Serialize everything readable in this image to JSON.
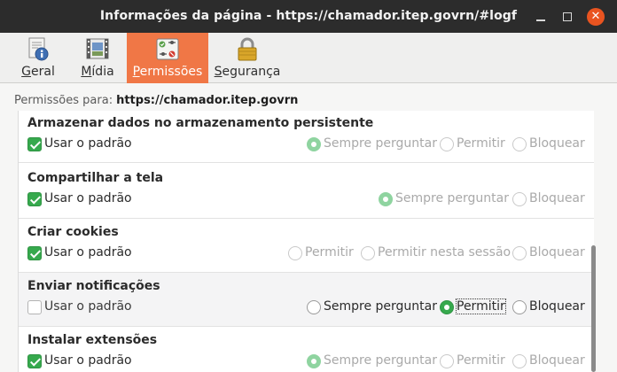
{
  "window": {
    "title": "Informações da página - https://chamador.itep.govrn/#logf",
    "minimize_glyph": "",
    "close_glyph": "✕"
  },
  "tabs": [
    {
      "label_u": "G",
      "label_rest": "eral",
      "icon": "page-info-icon"
    },
    {
      "label_u": "M",
      "label_rest": "ídia",
      "icon": "media-icon"
    },
    {
      "label_u": "P",
      "label_rest": "ermissões",
      "icon": "permissions-icon"
    },
    {
      "label_u": "S",
      "label_rest": "egurança",
      "icon": "lock-icon"
    }
  ],
  "active_tab": "Permissões",
  "permissions_for": {
    "label": "Permissões para:",
    "url": "https://chamador.itep.govrn"
  },
  "default_label": "Usar o padrão",
  "rows": [
    {
      "title": "Armazenar dados no armazenamento persistente",
      "use_default": true,
      "options": [
        "Sempre perguntar",
        "Permitir",
        "Bloquear"
      ],
      "selected": "Sempre perguntar"
    },
    {
      "title": "Compartilhar a tela",
      "use_default": true,
      "options": [
        "Sempre perguntar",
        "Bloquear"
      ],
      "selected": "Sempre perguntar"
    },
    {
      "title": "Criar cookies",
      "use_default": true,
      "options": [
        "Permitir",
        "Permitir nesta sessão",
        "Bloquear"
      ],
      "selected": ""
    },
    {
      "title": "Enviar notificações",
      "use_default": false,
      "options": [
        "Sempre perguntar",
        "Permitir",
        "Bloquear"
      ],
      "selected": "Permitir"
    },
    {
      "title": "Instalar extensões",
      "use_default": true,
      "options": [
        "Sempre perguntar",
        "Permitir",
        "Bloquear"
      ],
      "selected": "Sempre perguntar"
    }
  ],
  "colors": {
    "accent": "#f07746",
    "titlebar": "#2c2c2c",
    "close_button": "#e95420",
    "checkbox_green": "#36a94d"
  }
}
